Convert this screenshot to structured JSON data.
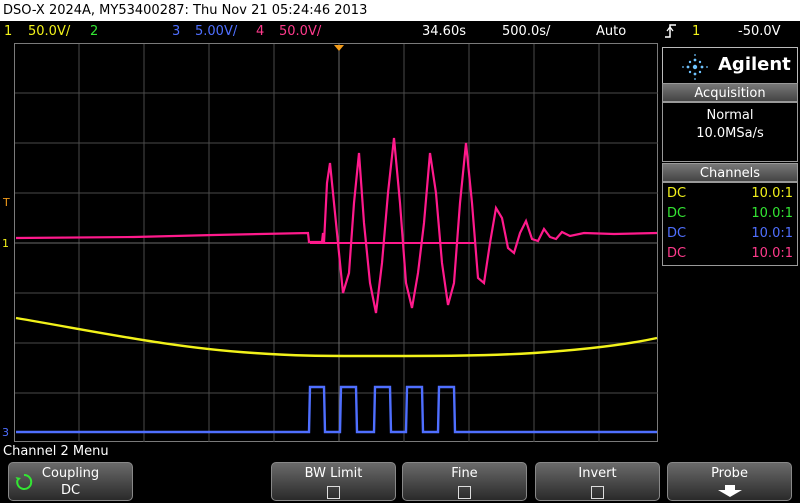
{
  "title": "DSO-X 2024A, MY53400287: Thu Nov 21 05:24:46 2013",
  "status": {
    "ch1": {
      "num": "1",
      "scale": "50.0V/",
      "color": "#f2f21a"
    },
    "ch2": {
      "num": "2",
      "scale": "",
      "color": "#33e633"
    },
    "ch3": {
      "num": "3",
      "scale": "5.00V/",
      "color": "#4f6fff"
    },
    "ch4": {
      "num": "4",
      "scale": "50.0V/",
      "color": "#ff3a8c"
    },
    "time_pos": "34.60s",
    "time_scale": "500.0s/",
    "trigger_mode": "Auto",
    "trigger_slope_icon": "rising-edge-icon",
    "trigger_ch": "1",
    "trigger_level": "-50.0V"
  },
  "brand": {
    "name": "Agilent"
  },
  "acquisition": {
    "header": "Acquisition",
    "mode": "Normal",
    "rate": "10.0MSa/s"
  },
  "channels": {
    "header": "Channels",
    "rows": [
      {
        "coupling": "DC",
        "probe": "10.0:1",
        "color": "#f2f21a"
      },
      {
        "coupling": "DC",
        "probe": "10.0:1",
        "color": "#33e633"
      },
      {
        "coupling": "DC",
        "probe": "10.0:1",
        "color": "#4f6fff"
      },
      {
        "coupling": "DC",
        "probe": "10.0:1",
        "color": "#ff3a8c"
      }
    ]
  },
  "markers": {
    "trigger": "T",
    "ch1": "1",
    "ch3": "3"
  },
  "menu": {
    "title": "Channel 2 Menu",
    "softkeys": [
      {
        "label": "Coupling",
        "value": "DC"
      },
      {
        "label": "BW Limit"
      },
      {
        "label": "Fine"
      },
      {
        "label": "Invert"
      },
      {
        "label": "Probe"
      }
    ]
  },
  "colors": {
    "grid": "#5a5a5a",
    "panel_border": "#999999"
  }
}
